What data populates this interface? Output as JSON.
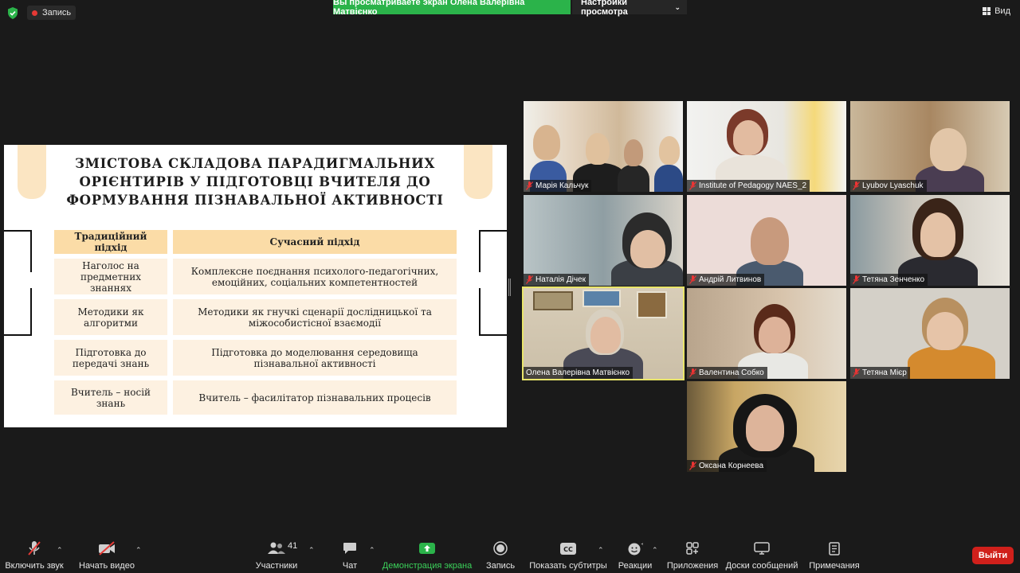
{
  "topbar": {
    "record_label": "Запись",
    "share_banner": "Вы просматриваете экран Олена Валерівна Матвієнко",
    "view_settings": "Настройки просмотра",
    "view_label": "Вид"
  },
  "slide": {
    "title_line1": "ЗМІСТОВА СКЛАДОВА ПАРАДИГМАЛЬНИХ",
    "title_line2": "ОРІЄНТИРІВ У ПІДГОТОВЦІ ВЧИТЕЛЯ ДО",
    "title_line3": "ФОРМУВАННЯ ПІЗНАВАЛЬНОЇ АКТИВНОСТІ",
    "header_left": "Традиційний підхід",
    "header_right": "Сучасний підхід",
    "rows": [
      {
        "left": "Наголос на предметних знаннях",
        "right": "Комплексне поєднання психолого-педагогічних, емоційних, соціальних компетентностей"
      },
      {
        "left": "Методики як алгоритми",
        "right": "Методики як гнучкі сценарії дослідницької та міжособистісної взаємодії"
      },
      {
        "left": "Підготовка до передачі знань",
        "right": "Підготовка до моделювання середовища пізнавальної активності"
      },
      {
        "left": "Вчитель – носій знань",
        "right": "Вчитель – фасилітатор пізнавальних процесів"
      }
    ]
  },
  "participants": [
    {
      "name": "Марія Кальчук"
    },
    {
      "name": "Institute of Pedagogy NAES_2"
    },
    {
      "name": "Lyubov Lyaschuk"
    },
    {
      "name": "Наталія Дічек"
    },
    {
      "name": "Андрій Литвинов"
    },
    {
      "name": "Тетяна Зенченко"
    },
    {
      "name": "Олена Валерівна Матвієнко"
    },
    {
      "name": "Валентина Собко"
    },
    {
      "name": "Тетяна Мієр"
    },
    {
      "name": "Оксана Корнеева"
    }
  ],
  "toolbar": {
    "audio": "Включить звук",
    "video": "Начать видео",
    "participants": "Участники",
    "participants_count": "41",
    "chat": "Чат",
    "share": "Демонстрация экрана",
    "record": "Запись",
    "captions": "Показать субтитры",
    "reactions": "Реакции",
    "apps": "Приложения",
    "whiteboards": "Доски сообщений",
    "notes": "Примечания",
    "leave": "Выйти"
  },
  "colors": {
    "share_banner": "#2bb34a",
    "leave": "#d0201b",
    "active_speaker": "#e9e56a",
    "table_header": "#fbdca7",
    "table_body": "#fdf1e1"
  }
}
